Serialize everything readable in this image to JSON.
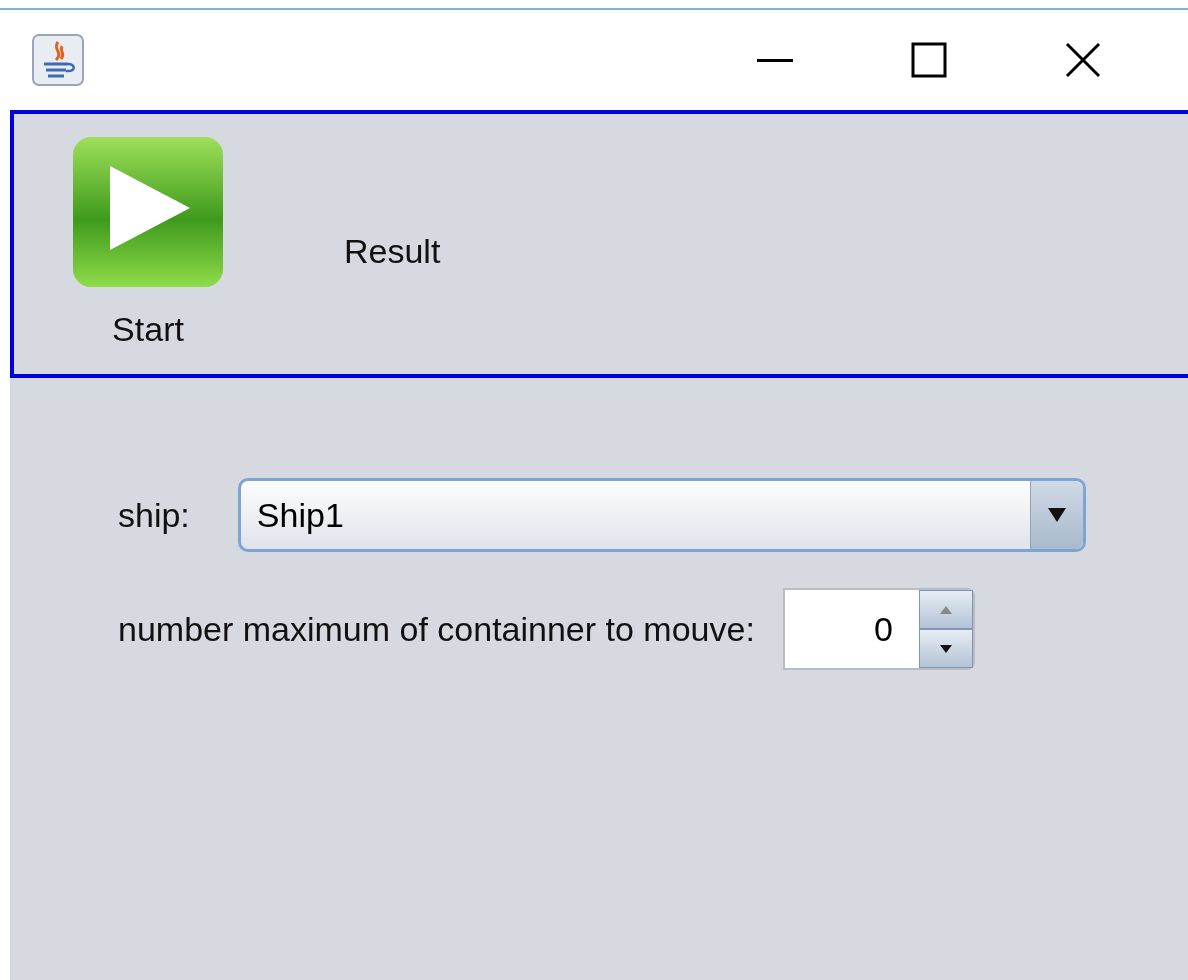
{
  "toolbar": {
    "buttons": [
      {
        "label": "Start",
        "kind": "play"
      },
      {
        "label": "Result",
        "kind": "text"
      }
    ]
  },
  "form": {
    "ship": {
      "label": "ship:",
      "value": "Ship1"
    },
    "max_containers": {
      "label": "number maximum of containner to mouve:",
      "value": "0"
    }
  }
}
